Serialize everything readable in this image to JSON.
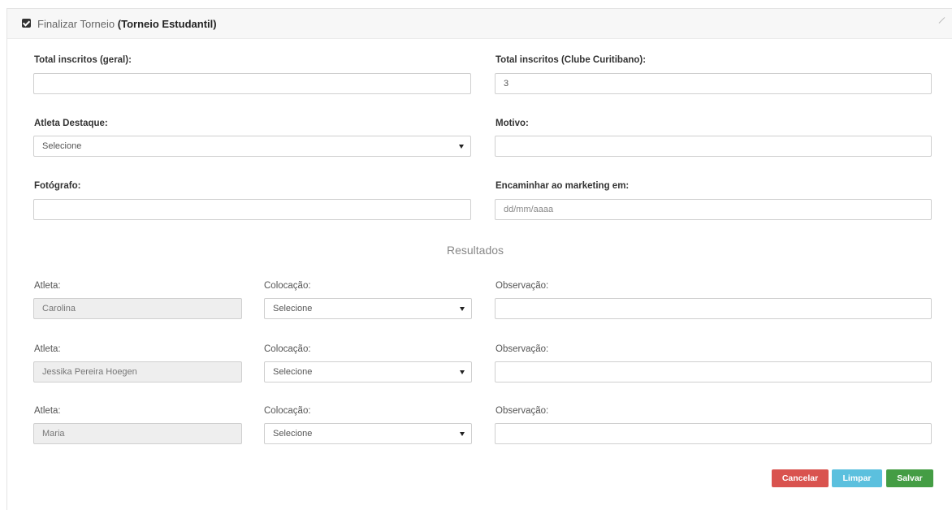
{
  "header": {
    "prefix": "Finalizar Torneio",
    "tournament": "(Torneio Estudantil)"
  },
  "fields": {
    "total_geral_label": "Total inscritos (geral):",
    "total_geral_value": "",
    "total_clube_label": "Total inscritos (Clube Curitibano):",
    "total_clube_value": "3",
    "atleta_destaque_label": "Atleta Destaque:",
    "atleta_destaque_value": "Selecione",
    "motivo_label": "Motivo:",
    "motivo_value": "",
    "fotografo_label": "Fotógrafo:",
    "fotografo_value": "",
    "marketing_label": "Encaminhar ao marketing em:",
    "marketing_placeholder": "dd/mm/aaaa"
  },
  "results": {
    "title": "Resultados",
    "rows": [
      {
        "atleta_label": "Atleta:",
        "atleta": "Carolina",
        "colocacao_label": "Colocação:",
        "colocacao": "Selecione",
        "obs_label": "Observação:",
        "obs": ""
      },
      {
        "atleta_label": "Atleta:",
        "atleta": "Jessika Pereira Hoegen",
        "colocacao_label": "Colocação:",
        "colocacao": "Selecione",
        "obs_label": "Observação:",
        "obs": ""
      },
      {
        "atleta_label": "Atleta:",
        "atleta": "Maria",
        "colocacao_label": "Colocação:",
        "colocacao": "Selecione",
        "obs_label": "Observação:",
        "obs": ""
      }
    ]
  },
  "buttons": {
    "cancelar": "Cancelar",
    "limpar": "Limpar",
    "salvar": "Salvar"
  },
  "colors": {
    "cancelar": "#d9534f",
    "limpar": "#5bc0de",
    "salvar": "#449d44"
  }
}
